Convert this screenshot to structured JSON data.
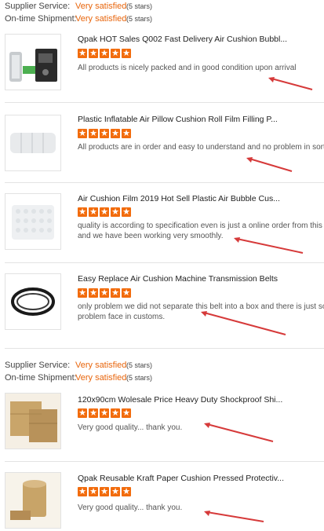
{
  "supplier_ratings": [
    {
      "rows": [
        {
          "label": "Supplier Service:",
          "value": "Very satisfied",
          "stars": "(5 stars)"
        },
        {
          "label": "On-time Shipment:",
          "value": "Very satisfied",
          "stars": "(5 stars)"
        }
      ]
    },
    {
      "rows": [
        {
          "label": "Supplier Service:",
          "value": "Very satisfied",
          "stars": "(5 stars)"
        },
        {
          "label": "On-time Shipment:",
          "value": "Very satisfied",
          "stars": "(5 stars)"
        }
      ]
    }
  ],
  "reviews": [
    {
      "title": "Qpak HOT Sales Q002 Fast Delivery Air Cushion Bubbl...",
      "rating": 5,
      "text": [
        "All products is nicely packed and in good condition upon arrival"
      ]
    },
    {
      "title": "Plastic Inflatable Air Pillow Cushion Roll Film Filling P...",
      "rating": 5,
      "text": [
        "All products are in order and easy to understand and no problem in sorting"
      ]
    },
    {
      "title": "Air Cushion Film 2019 Hot Sell Plastic Air Bubble Cus...",
      "rating": 5,
      "text": [
        "quality is according to specification even is just a online order from this su",
        "and we have been working very smoothly."
      ]
    },
    {
      "title": "Easy Replace Air Cushion Machine Transmission Belts",
      "rating": 5,
      "text": [
        "only problem we did not separate this belt into a box and there is just some",
        "problem face in customs."
      ]
    },
    {
      "title": "120x90cm Wolesale Price Heavy Duty Shockproof Shi...",
      "rating": 5,
      "text": [
        "Very good quality... thank you."
      ]
    },
    {
      "title": "Qpak Reusable Kraft Paper Cushion Pressed Protectiv...",
      "rating": 5,
      "text": [
        "Very good quality... thank you."
      ]
    }
  ],
  "colors": {
    "accent": "#f26c0d",
    "rating_text": "#e8650c",
    "annotation_arrow": "#d63a3a"
  }
}
